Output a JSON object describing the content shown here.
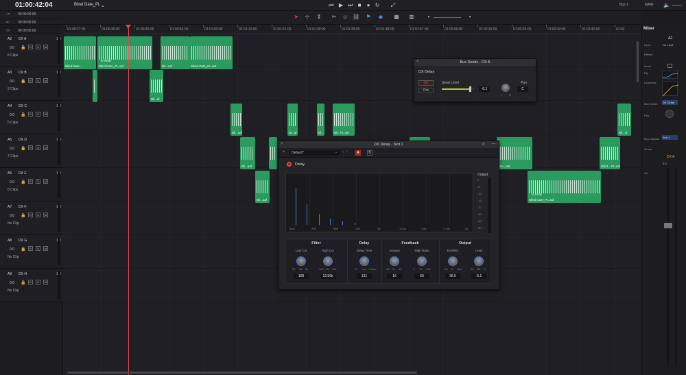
{
  "top": {
    "timecode": "01:00:42:04",
    "timeline_name": "Blind Date_PL",
    "bus_select": "Bus 1",
    "main_select": "MAIN"
  },
  "left_timecodes": [
    "00:00:00:00",
    "00:00:00:00",
    "00:00:00:00"
  ],
  "ruler_ticks": [
    "01:00:27:00",
    "01:00:36:00",
    "01:00:45:00",
    "01:00:54:00",
    "01:01:03:00",
    "01:01:12:00",
    "01:01:21:00",
    "01:01:30:00",
    "01:01:39:00",
    "01:01:48:00",
    "01:01:57:00",
    "01:02:06:00",
    "01:02:15:00",
    "01:02:24:00",
    "01:02:33:00",
    "01:02:42:00",
    "01:02"
  ],
  "tracks": [
    {
      "id": "A2",
      "name": "DX A",
      "vol": "1.0",
      "db": "0.0",
      "clips": "8 Clips"
    },
    {
      "id": "A3",
      "name": "DX B",
      "vol": "1.0",
      "db": "0.0",
      "clips": "2 Clips"
    },
    {
      "id": "A4",
      "name": "DX C",
      "vol": "1.0",
      "db": "0.0",
      "clips": "5 Clips"
    },
    {
      "id": "A5",
      "name": "DX D",
      "vol": "1.0",
      "db": "0.0",
      "clips": "7 Clips"
    },
    {
      "id": "A6",
      "name": "DX E",
      "vol": "1.0",
      "db": "0.0",
      "clips": "6 Clips"
    },
    {
      "id": "A7",
      "name": "DX F",
      "vol": "1.0",
      "db": "0.0",
      "clips": "No Clip"
    },
    {
      "id": "A8",
      "name": "DX G",
      "vol": "1.0",
      "db": "0.0",
      "clips": "No Clip"
    },
    {
      "id": "A9",
      "name": "DX H",
      "vol": "1.0",
      "db": "0.0",
      "clips": "No Clip"
    }
  ],
  "track_buttons": {
    "r": "R",
    "s": "S",
    "m": "M"
  },
  "clips": {
    "c1": "Blind Date...",
    "c2": "Blind Date_PL.aaf",
    "c2db": "-6.46dB",
    "c3": "Blind Date_PL.aaf",
    "c4": "Bli...aaf",
    "c5": "Bli...af",
    "c6": "Bl...af",
    "c7": "Bl...",
    "c8": "Bl...",
    "c9": "Bli...PL.aaf",
    "c10": "Bli...aaf",
    "c11": "Bli...aaf",
    "c12": "Blind ...PL.aaf",
    "c13": "Blin...aaf",
    "c14": "Blind Date_PL.aaf",
    "c14db": "-2.10dB",
    "c15": "Bli...af",
    "c16": "Blind ...PL.aaf",
    "c17": "Blind Date_PL.aaf"
  },
  "bus_sends": {
    "title": "Bus Sends - DX A",
    "section": "DX Delay",
    "on_label": "On",
    "pre_label": "Pre",
    "send_level_label": "Send Level",
    "send_level_value": "-0.1",
    "pan_label": "Pan",
    "pan_value": "C",
    "pan_l": "L",
    "pan_r": "R",
    "send_level_fraction": 0.85
  },
  "delay_plugin": {
    "title": "DX Delay - Slot 1",
    "preset": "Default*",
    "ab_a": "A",
    "ab_b": "B",
    "power_label": "Delay",
    "output_label": "Output",
    "freq_ticks": [
      "0ms",
      "20K",
      "50K",
      "100",
      "1k",
      "1.25k",
      "1.5k",
      "1.75k",
      "2s"
    ],
    "meter_ticks": [
      "0",
      "-5",
      "-10",
      "-15",
      "-20",
      "-30",
      "-40",
      "-50"
    ],
    "sections": {
      "filter": "Filter",
      "delay": "Delay",
      "feedback": "Feedback",
      "output": "Output"
    },
    "knobs": {
      "low_cut": {
        "label": "Low Cut",
        "value": "108",
        "min": "20",
        "unit": "Hz",
        "max": "5k"
      },
      "high_cut": {
        "label": "High Cut",
        "value": "12.50k",
        "min": "100",
        "unit": "Hz",
        "max": "20k"
      },
      "delay_time": {
        "label": "Delay Time",
        "value": "121",
        "min": "0",
        "unit": "ms",
        "max": "1.2sec"
      },
      "amount": {
        "label": "Amount",
        "value": "16",
        "min": "-99",
        "unit": "%",
        "max": "99"
      },
      "high_ratio": {
        "label": "High Ratio",
        "value": "60",
        "min": "0",
        "unit": "%",
        "max": "100"
      },
      "dry_wet": {
        "label": "Dry/Wet",
        "value": "36.5",
        "min": "0%",
        "unit": "%",
        "max": "Wet"
      },
      "level": {
        "label": "Level",
        "value": "-5.1",
        "min": "-24",
        "unit": "dB",
        "max": "+6"
      }
    }
  },
  "mixer": {
    "title": "Mixer",
    "channel": "A2",
    "labels": [
      "Input",
      "Effects",
      "Insert",
      "EQ",
      "Dynamics",
      "Bus Sends",
      "Pan",
      "Bus Outputs",
      "Group"
    ],
    "input_value": "No Input",
    "bus_send_value": "DX Delay",
    "bus_output_value": "Bus 1",
    "channel_name": "DX A",
    "db_label": "dB",
    "fader_value": "0.0"
  },
  "colors": {
    "clip": "#2a9a5e",
    "playhead": "#e84545",
    "knob_ring": "#4a6fd8",
    "accent_red": "#e84545"
  }
}
